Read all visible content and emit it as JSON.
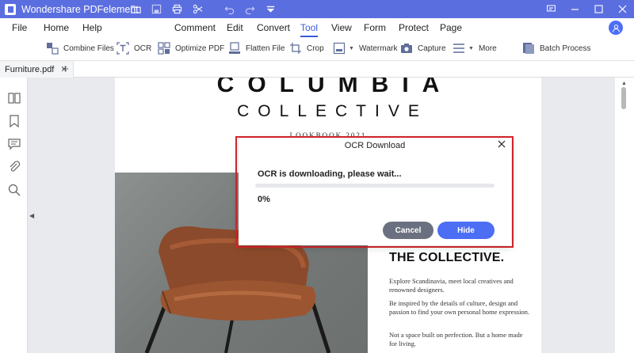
{
  "titlebar": {
    "app_title": "Wondershare PDFelement",
    "icons": [
      "folder-icon",
      "save-icon",
      "print-icon",
      "scissors-icon",
      "undo-icon",
      "redo-icon",
      "dropdown-icon"
    ]
  },
  "menu": {
    "file": "File",
    "home": "Home",
    "help": "Help",
    "comment": "Comment",
    "edit": "Edit",
    "convert": "Convert",
    "tool": "Tool",
    "view": "View",
    "form": "Form",
    "protect": "Protect",
    "page": "Page"
  },
  "toolbar": {
    "combine_files": "Combine Files",
    "ocr": "OCR",
    "optimize_pdf": "Optimize PDF",
    "flatten_file": "Flatten File",
    "crop": "Crop",
    "watermark": "Watermark",
    "capture": "Capture",
    "more": "More",
    "batch_process": "Batch Process"
  },
  "tabs": {
    "current": "Furniture.pdf",
    "add_label": "+"
  },
  "document": {
    "title": "COLUMBIA",
    "subtitle": "COLLECTIVE",
    "lookbook": "LOOKBOOK 2021",
    "headline": "THE COLLECTIVE.",
    "para1": "Explore Scandinavia, meet local creatives and renowned designers.",
    "para2": "Be inspired by the details of culture, design and passion to find your own personal home expression.",
    "para3": "Not a space built on perfection. But a home made for living."
  },
  "dialog": {
    "title": "OCR Download",
    "message": "OCR is downloading, please wait...",
    "progress_fraction": 0,
    "progress_text": "0%",
    "cancel_label": "Cancel",
    "hide_label": "Hide"
  },
  "colors": {
    "accent": "#4c6ef5",
    "titlebar": "#5b6ee0",
    "highlight": "#d9262c"
  }
}
